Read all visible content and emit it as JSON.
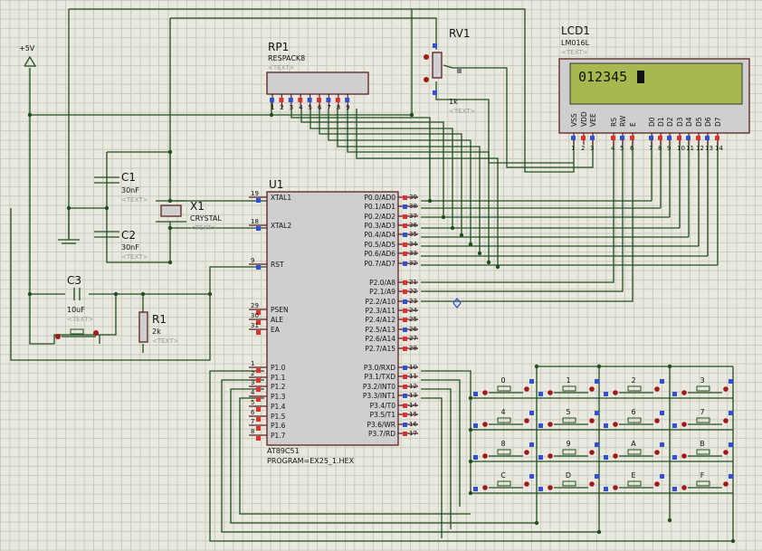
{
  "power": {
    "label": "+5V"
  },
  "mcu": {
    "ref": "U1",
    "part": "AT89C51",
    "program": "PROGRAM=EX25_1.HEX",
    "left_pins": [
      {
        "num": "19",
        "name": "XTAL1"
      },
      {
        "num": "18",
        "name": "XTAL2"
      },
      {
        "num": "9",
        "name": "RST"
      },
      {
        "num": "29",
        "name": "PSEN"
      },
      {
        "num": "30",
        "name": "ALE"
      },
      {
        "num": "31",
        "name": "EA"
      },
      {
        "num": "1",
        "name": "P1.0"
      },
      {
        "num": "2",
        "name": "P1.1"
      },
      {
        "num": "3",
        "name": "P1.2"
      },
      {
        "num": "4",
        "name": "P1.3"
      },
      {
        "num": "5",
        "name": "P1.4"
      },
      {
        "num": "6",
        "name": "P1.5"
      },
      {
        "num": "7",
        "name": "P1.6"
      },
      {
        "num": "8",
        "name": "P1.7"
      }
    ],
    "right_pins": [
      {
        "num": "39",
        "name": "P0.0/AD0"
      },
      {
        "num": "38",
        "name": "P0.1/AD1"
      },
      {
        "num": "37",
        "name": "P0.2/AD2"
      },
      {
        "num": "36",
        "name": "P0.3/AD3"
      },
      {
        "num": "35",
        "name": "P0.4/AD4"
      },
      {
        "num": "34",
        "name": "P0.5/AD5"
      },
      {
        "num": "33",
        "name": "P0.6/AD6"
      },
      {
        "num": "32",
        "name": "P0.7/AD7"
      },
      {
        "num": "21",
        "name": "P2.0/A8"
      },
      {
        "num": "22",
        "name": "P2.1/A9"
      },
      {
        "num": "23",
        "name": "P2.2/A10"
      },
      {
        "num": "24",
        "name": "P2.3/A11"
      },
      {
        "num": "25",
        "name": "P2.4/A12"
      },
      {
        "num": "26",
        "name": "P2.5/A13"
      },
      {
        "num": "27",
        "name": "P2.6/A14"
      },
      {
        "num": "28",
        "name": "P2.7/A15"
      },
      {
        "num": "10",
        "name": "P3.0/RXD"
      },
      {
        "num": "11",
        "name": "P3.1/TXD"
      },
      {
        "num": "12",
        "name": "P3.2/INT0"
      },
      {
        "num": "13",
        "name": "P3.3/INT1"
      },
      {
        "num": "14",
        "name": "P3.4/T0"
      },
      {
        "num": "15",
        "name": "P3.5/T1"
      },
      {
        "num": "16",
        "name": "P3.6/WR"
      },
      {
        "num": "17",
        "name": "P3.7/RD"
      }
    ]
  },
  "rp1": {
    "ref": "RP1",
    "part": "RESPACK8",
    "text": "<TEXT>",
    "pins": [
      "1",
      "2",
      "3",
      "4",
      "5",
      "6",
      "7",
      "8",
      "9"
    ]
  },
  "rv1": {
    "ref": "RV1",
    "value": "1k",
    "text": "<TEXT>"
  },
  "lcd": {
    "ref": "LCD1",
    "part": "LM016L",
    "text": "<TEXT>",
    "display": "012345",
    "pins": [
      {
        "num": "1",
        "name": "VSS"
      },
      {
        "num": "2",
        "name": "VDD"
      },
      {
        "num": "3",
        "name": "VEE"
      },
      {
        "num": "4",
        "name": "RS"
      },
      {
        "num": "5",
        "name": "RW"
      },
      {
        "num": "6",
        "name": "E"
      },
      {
        "num": "7",
        "name": "D0"
      },
      {
        "num": "8",
        "name": "D1"
      },
      {
        "num": "9",
        "name": "D2"
      },
      {
        "num": "10",
        "name": "D3"
      },
      {
        "num": "11",
        "name": "D4"
      },
      {
        "num": "12",
        "name": "D5"
      },
      {
        "num": "13",
        "name": "D6"
      },
      {
        "num": "14",
        "name": "D7"
      }
    ]
  },
  "x1": {
    "ref": "X1",
    "part": "CRYSTAL",
    "text": "<TEXT>"
  },
  "c1": {
    "ref": "C1",
    "value": "30nF",
    "text": "<TEXT>"
  },
  "c2": {
    "ref": "C2",
    "value": "30nF",
    "text": "<TEXT>"
  },
  "c3": {
    "ref": "C3",
    "value": "10uF",
    "text": "<TEXT>"
  },
  "r1": {
    "ref": "R1",
    "value": "2k",
    "text": "<TEXT>"
  },
  "keypad": {
    "keys": [
      "0",
      "1",
      "2",
      "3",
      "4",
      "5",
      "6",
      "7",
      "8",
      "9",
      "A",
      "B",
      "C",
      "D",
      "E",
      "F"
    ]
  },
  "colors": {
    "wire": "#1f4f1f",
    "body_fill": "#cfcfcf",
    "body_stroke": "#5a2020",
    "pin_in": "#3050d8",
    "pin_out": "#e03030",
    "lcd_screen": "#a8b84e"
  }
}
